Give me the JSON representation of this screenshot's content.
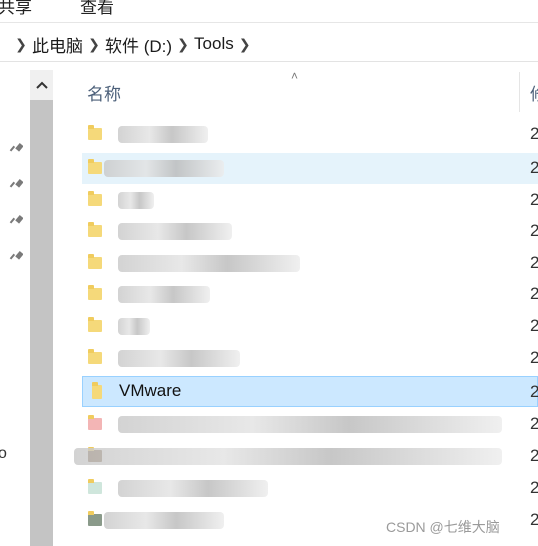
{
  "ribbon": {
    "tabs": [
      "共享",
      "查看"
    ]
  },
  "address": {
    "crumbs": [
      "此电脑",
      "软件 (D:)",
      "Tools"
    ]
  },
  "header": {
    "name_col": "名称",
    "next_col": "修"
  },
  "rows": [
    {
      "name": "",
      "date_prefix": "2",
      "state": "normal"
    },
    {
      "name": "",
      "date_prefix": "2",
      "state": "hover"
    },
    {
      "name": "",
      "date_prefix": "2",
      "state": "normal"
    },
    {
      "name": "",
      "date_prefix": "2",
      "state": "normal"
    },
    {
      "name": "",
      "date_prefix": "2",
      "state": "normal"
    },
    {
      "name": "",
      "date_prefix": "2",
      "state": "normal"
    },
    {
      "name": "",
      "date_prefix": "2",
      "state": "normal"
    },
    {
      "name": "",
      "date_prefix": "2",
      "state": "normal"
    },
    {
      "name": "VMware",
      "date_prefix": "2",
      "state": "selected"
    },
    {
      "name": "",
      "date_prefix": "2",
      "state": "normal"
    },
    {
      "name": "",
      "date_prefix": "2",
      "state": "normal"
    },
    {
      "name": "",
      "date_prefix": "2",
      "state": "normal"
    },
    {
      "name": "",
      "date_prefix": "2",
      "state": "normal"
    }
  ],
  "nav": {
    "partial_letter": "o"
  },
  "icons": [
    "pin-icon",
    "pin-icon",
    "pin-icon",
    "pin-icon",
    "chevron-up-icon",
    "chevron-right-icon",
    "folder-icon",
    "sort-up-icon"
  ],
  "watermark": "CSDN @七维大脑"
}
